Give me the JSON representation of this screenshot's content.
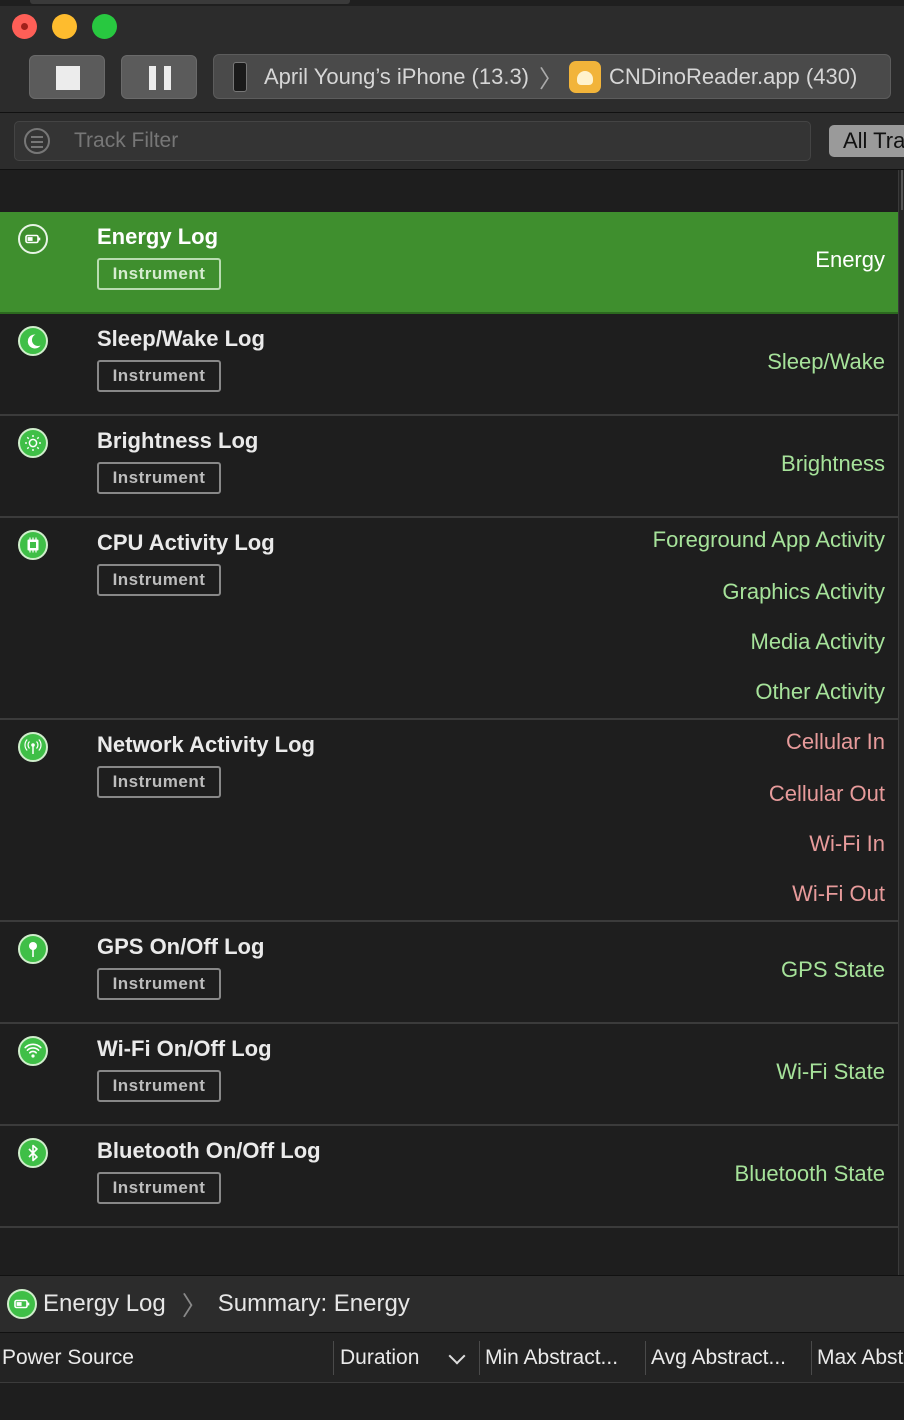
{
  "toolbar": {
    "device": "April Young’s iPhone (13.3)",
    "app": "CNDinoReader.app (430)"
  },
  "filter": {
    "placeholder": "Track Filter",
    "scope_button": "All Tracks"
  },
  "tracks": [
    {
      "name": "Energy Log",
      "badge": "Instrument",
      "icon": "battery-icon",
      "labels": [
        "Energy"
      ],
      "label_color": "white",
      "selected": true
    },
    {
      "name": "Sleep/Wake Log",
      "badge": "Instrument",
      "icon": "moon-icon",
      "labels": [
        "Sleep/Wake"
      ],
      "label_color": "green",
      "selected": false
    },
    {
      "name": "Brightness Log",
      "badge": "Instrument",
      "icon": "sun-icon",
      "labels": [
        "Brightness"
      ],
      "label_color": "green",
      "selected": false
    },
    {
      "name": "CPU Activity Log",
      "badge": "Instrument",
      "icon": "cpu-icon",
      "labels": [
        "Foreground App Activity",
        "Graphics Activity",
        "Media Activity",
        "Other Activity"
      ],
      "label_color": "green",
      "selected": false
    },
    {
      "name": "Network Activity Log",
      "badge": "Instrument",
      "icon": "antenna-icon",
      "labels": [
        "Cellular In",
        "Cellular Out",
        "Wi-Fi In",
        "Wi-Fi Out"
      ],
      "label_color": "red",
      "selected": false
    },
    {
      "name": "GPS On/Off Log",
      "badge": "Instrument",
      "icon": "location-pin-icon",
      "labels": [
        "GPS State"
      ],
      "label_color": "green",
      "selected": false
    },
    {
      "name": "Wi-Fi On/Off Log",
      "badge": "Instrument",
      "icon": "wifi-icon",
      "labels": [
        "Wi-Fi State"
      ],
      "label_color": "green",
      "selected": false
    },
    {
      "name": "Bluetooth On/Off Log",
      "badge": "Instrument",
      "icon": "bluetooth-icon",
      "labels": [
        "Bluetooth State"
      ],
      "label_color": "green",
      "selected": false
    }
  ],
  "detail": {
    "instrument": "Energy Log",
    "view": "Summary: Energy"
  },
  "columns": [
    "Power Source",
    "Duration",
    "Min Abstract...",
    "Avg Abstract...",
    "Max Abstract..."
  ],
  "colors": {
    "selected_row": "#3f8f2e",
    "icon_green": "#3fbf47",
    "label_green": "#a6e29a",
    "label_red": "#e79b9b"
  }
}
